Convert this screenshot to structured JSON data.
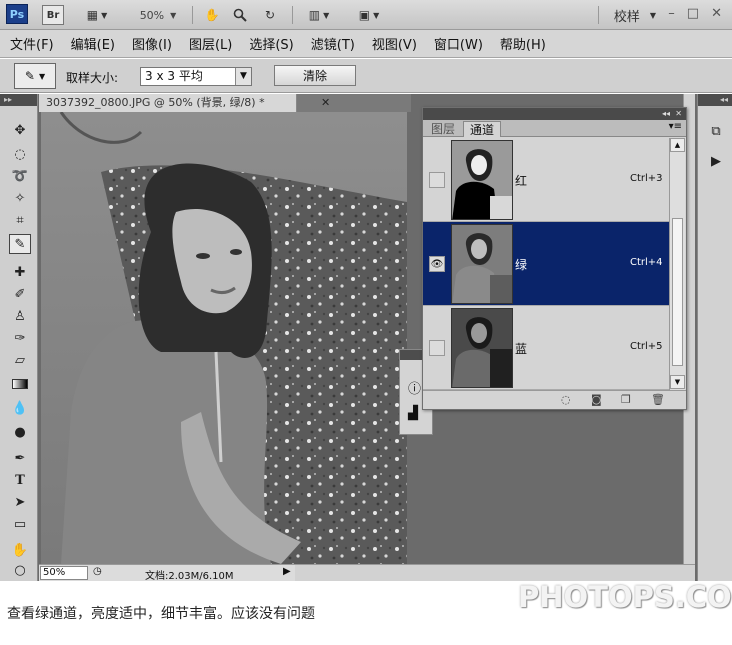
{
  "appbar": {
    "logo": "Ps",
    "bridge": "Br",
    "zoom": "50%",
    "workspace": "校样"
  },
  "menu": [
    "文件(F)",
    "编辑(E)",
    "图像(I)",
    "图层(L)",
    "选择(S)",
    "滤镜(T)",
    "视图(V)",
    "窗口(W)",
    "帮助(H)"
  ],
  "options": {
    "sample_size_label": "取样大小:",
    "sample_size_value": "3 x 3 平均",
    "clear_label": "清除"
  },
  "document": {
    "tab_title": "3037392_0800.JPG @ 50% (背景, 绿/8) *",
    "close": "✕",
    "zoom_field": "50%",
    "doc_size": "文档:2.03M/6.10M"
  },
  "channels_panel": {
    "tab_layers": "图层",
    "tab_channels": "通道",
    "channels": [
      {
        "name": "红",
        "shortcut": "Ctrl+3",
        "visible": false,
        "selected": false
      },
      {
        "name": "绿",
        "shortcut": "Ctrl+4",
        "visible": true,
        "selected": true
      },
      {
        "name": "蓝",
        "shortcut": "Ctrl+5",
        "visible": false,
        "selected": false
      }
    ]
  },
  "caption": "查看绿通道，亮度适中，细节丰富。应该没有问题",
  "watermark": "PHOTOPS.COM",
  "colors": {
    "selection": "#0a246a",
    "ps_logo": "#1c3f8a"
  }
}
